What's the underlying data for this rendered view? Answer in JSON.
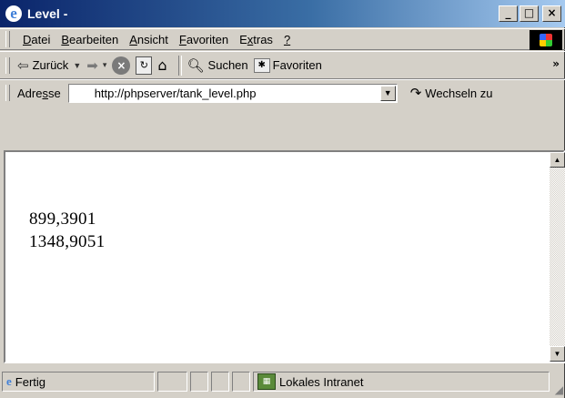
{
  "window": {
    "title": "Level -",
    "buttons": {
      "minimize": "_",
      "maximize": "□",
      "close": "×"
    }
  },
  "menu": [
    {
      "pre": "",
      "accel": "D",
      "post": "atei"
    },
    {
      "pre": "",
      "accel": "B",
      "post": "earbeiten"
    },
    {
      "pre": "",
      "accel": "A",
      "post": "nsicht"
    },
    {
      "pre": "",
      "accel": "F",
      "post": "avoriten"
    },
    {
      "pre": "E",
      "accel": "x",
      "post": "tras"
    },
    {
      "pre": "",
      "accel": "?",
      "post": ""
    }
  ],
  "toolbar": {
    "back_label": "Zurück",
    "search_label": "Suchen",
    "favorites_label": "Favoriten",
    "more": "»"
  },
  "address": {
    "label_pre": "Adre",
    "label_accel": "s",
    "label_post": "se",
    "url": "http://phpserver/tank_level.php",
    "go_label": "Wechseln zu"
  },
  "content": {
    "lines": [
      "899,3901",
      "1348,9051"
    ]
  },
  "status": {
    "text": "Fertig",
    "zone": "Lokales Intranet"
  },
  "icons": [
    "ie-logo-icon",
    "back-arrow-icon",
    "forward-arrow-icon",
    "stop-icon",
    "refresh-icon",
    "home-icon",
    "search-icon",
    "favorites-icon",
    "go-icon",
    "intranet-icon",
    "windows-logo-icon"
  ]
}
